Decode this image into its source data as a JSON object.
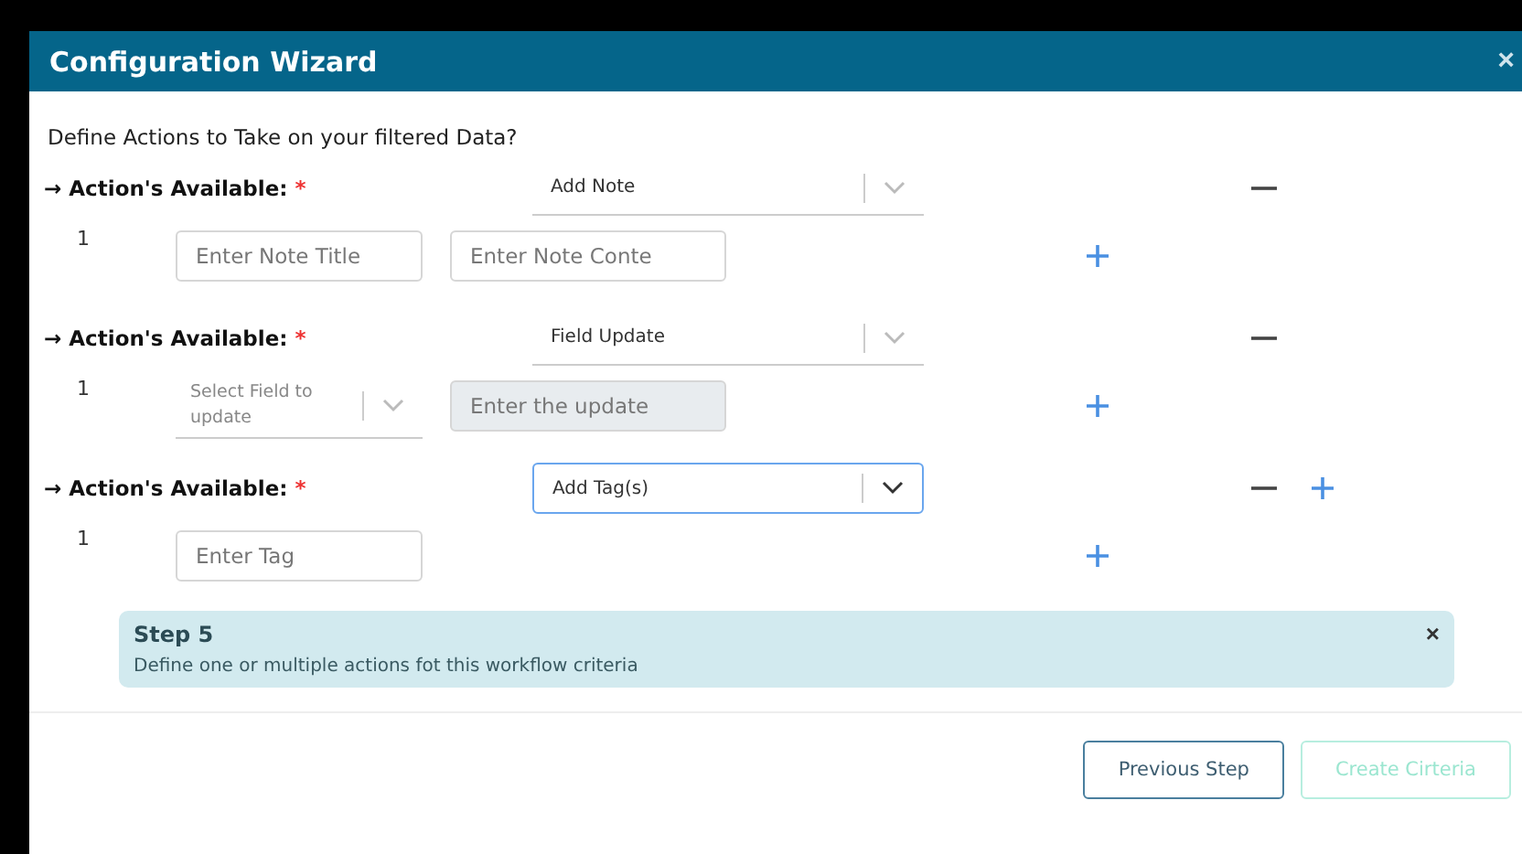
{
  "window": {
    "title": "Configuration Wizard",
    "close": "×"
  },
  "question": "Define Actions to Take on your filtered Data?",
  "actions": [
    {
      "arrow": "→",
      "label": "Action's Available:",
      "required": "*",
      "value": "Add Note",
      "focused": false,
      "add_action": false,
      "rows": [
        {
          "number": "1",
          "fields": [
            {
              "kind": "input",
              "placeholder": "Enter Note Title",
              "disabled": false
            },
            {
              "kind": "input",
              "placeholder": "Enter Note Conte",
              "disabled": false
            }
          ]
        }
      ]
    },
    {
      "arrow": "→",
      "label": "Action's Available:",
      "required": "*",
      "value": "Field Update",
      "focused": false,
      "add_action": false,
      "rows": [
        {
          "number": "1",
          "fields": [
            {
              "kind": "select",
              "placeholder": "Select Field to update"
            },
            {
              "kind": "input",
              "placeholder": "Enter the update",
              "disabled": true
            }
          ]
        }
      ]
    },
    {
      "arrow": "→",
      "label": "Action's Available:",
      "required": "*",
      "value": "Add Tag(s)",
      "focused": true,
      "add_action": true,
      "rows": [
        {
          "number": "1",
          "fields": [
            {
              "kind": "input",
              "placeholder": "Enter Tag",
              "disabled": false
            }
          ]
        }
      ]
    }
  ],
  "alert": {
    "title": "Step 5",
    "text": "Define one or multiple actions fot this workflow criteria",
    "close": "×"
  },
  "buttons": [
    {
      "label": "Previous Step",
      "disabled": false
    },
    {
      "label": "Create Cirteria",
      "disabled": true
    }
  ]
}
